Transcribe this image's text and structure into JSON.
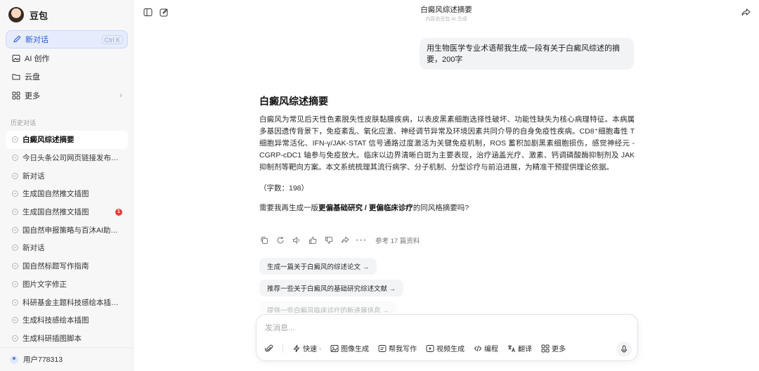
{
  "app": {
    "name": "豆包"
  },
  "sidebar": {
    "menu": [
      {
        "label": "新对话",
        "shortcut": "Ctrl K",
        "icon": "new-chat-icon"
      },
      {
        "label": "AI 创作",
        "icon": "image-icon"
      },
      {
        "label": "云盘",
        "icon": "folder-icon"
      },
      {
        "label": "更多",
        "icon": "grid-icon"
      }
    ],
    "history_label": "历史对话",
    "history": [
      {
        "label": "白癜风综述摘要"
      },
      {
        "label": "今日头条公司网页链接发布合规..."
      },
      {
        "label": "新对话"
      },
      {
        "label": "生成国自然推文插图"
      },
      {
        "label": "生成国自然推文插图",
        "badge": "1"
      },
      {
        "label": "国自然申报策略与百沐AI助力插..."
      },
      {
        "label": "新对话"
      },
      {
        "label": "国自然标题写作指南"
      },
      {
        "label": "图片文字修正"
      },
      {
        "label": "科研基金主题科技感绘本插图脚..."
      },
      {
        "label": "生成科技感绘本插图"
      },
      {
        "label": "生成科研插图脚本"
      }
    ],
    "user": "用户778313"
  },
  "topbar": {
    "title": "白癜风综述摘要",
    "subtitle": "内容由豆包 AI 生成"
  },
  "chat": {
    "user_message": "用生物医学专业术语帮我生成一段有关于白癜风综述的摘要，200字",
    "answer_title": "白癜风综述摘要",
    "answer_body": "白癜风为常见后天性色素脱失性皮肤黏膜疾病，以表皮黑素细胞选择性破坏、功能性缺失为核心病理特征。本病属多基因遗传背景下，免疫紊乱、氧化应激、神经调节异常及环境因素共同介导的自身免疫性疾病。CD8⁺细胞毒性 T 细胞异常活化、IFN-γ/JAK-STAT 信号通路过度激活为关键免疫机制，ROS 蓄积加剧黑素细胞损伤，感觉神经元 - CGRP-cDC1 轴参与免疫放大。临床以边界清晰白斑为主要表现，治疗涵盖光疗、激素、钙调磷酸酶抑制剂及 JAK 抑制剂等靶向方案。本文系统梳理其流行病学、分子机制、分型诊疗与前沿进展，为精准干预提供理论依据。",
    "word_count": "（字数：198）",
    "follow_prefix": "需要我再生成一版",
    "follow_bold": "更偏基础研究 / 更偏临床诊疗",
    "follow_suffix": "的同风格摘要吗?",
    "refs": "参考 17 篇资料",
    "suggestions": [
      "生成一篇关于白癜风的综述论文 →",
      "推荐一些关于白癜风的基础研究综述文献 →",
      "提供一些白癜风临床诊疗的新进展信息 →"
    ]
  },
  "input": {
    "placeholder": "发消息...",
    "tools": [
      {
        "label": "快速",
        "icon": "lightning-icon"
      },
      {
        "label": "图像生成",
        "icon": "image-icon"
      },
      {
        "label": "帮我写作",
        "icon": "write-icon"
      },
      {
        "label": "视频生成",
        "icon": "video-icon"
      },
      {
        "label": "编程",
        "icon": "code-icon"
      },
      {
        "label": "翻译",
        "icon": "translate-icon"
      },
      {
        "label": "更多",
        "icon": "grid-icon"
      }
    ]
  },
  "colors": {
    "accent": "#2a5bd7",
    "active_bg": "#e6ecfb",
    "badge": "#e93a3a"
  }
}
